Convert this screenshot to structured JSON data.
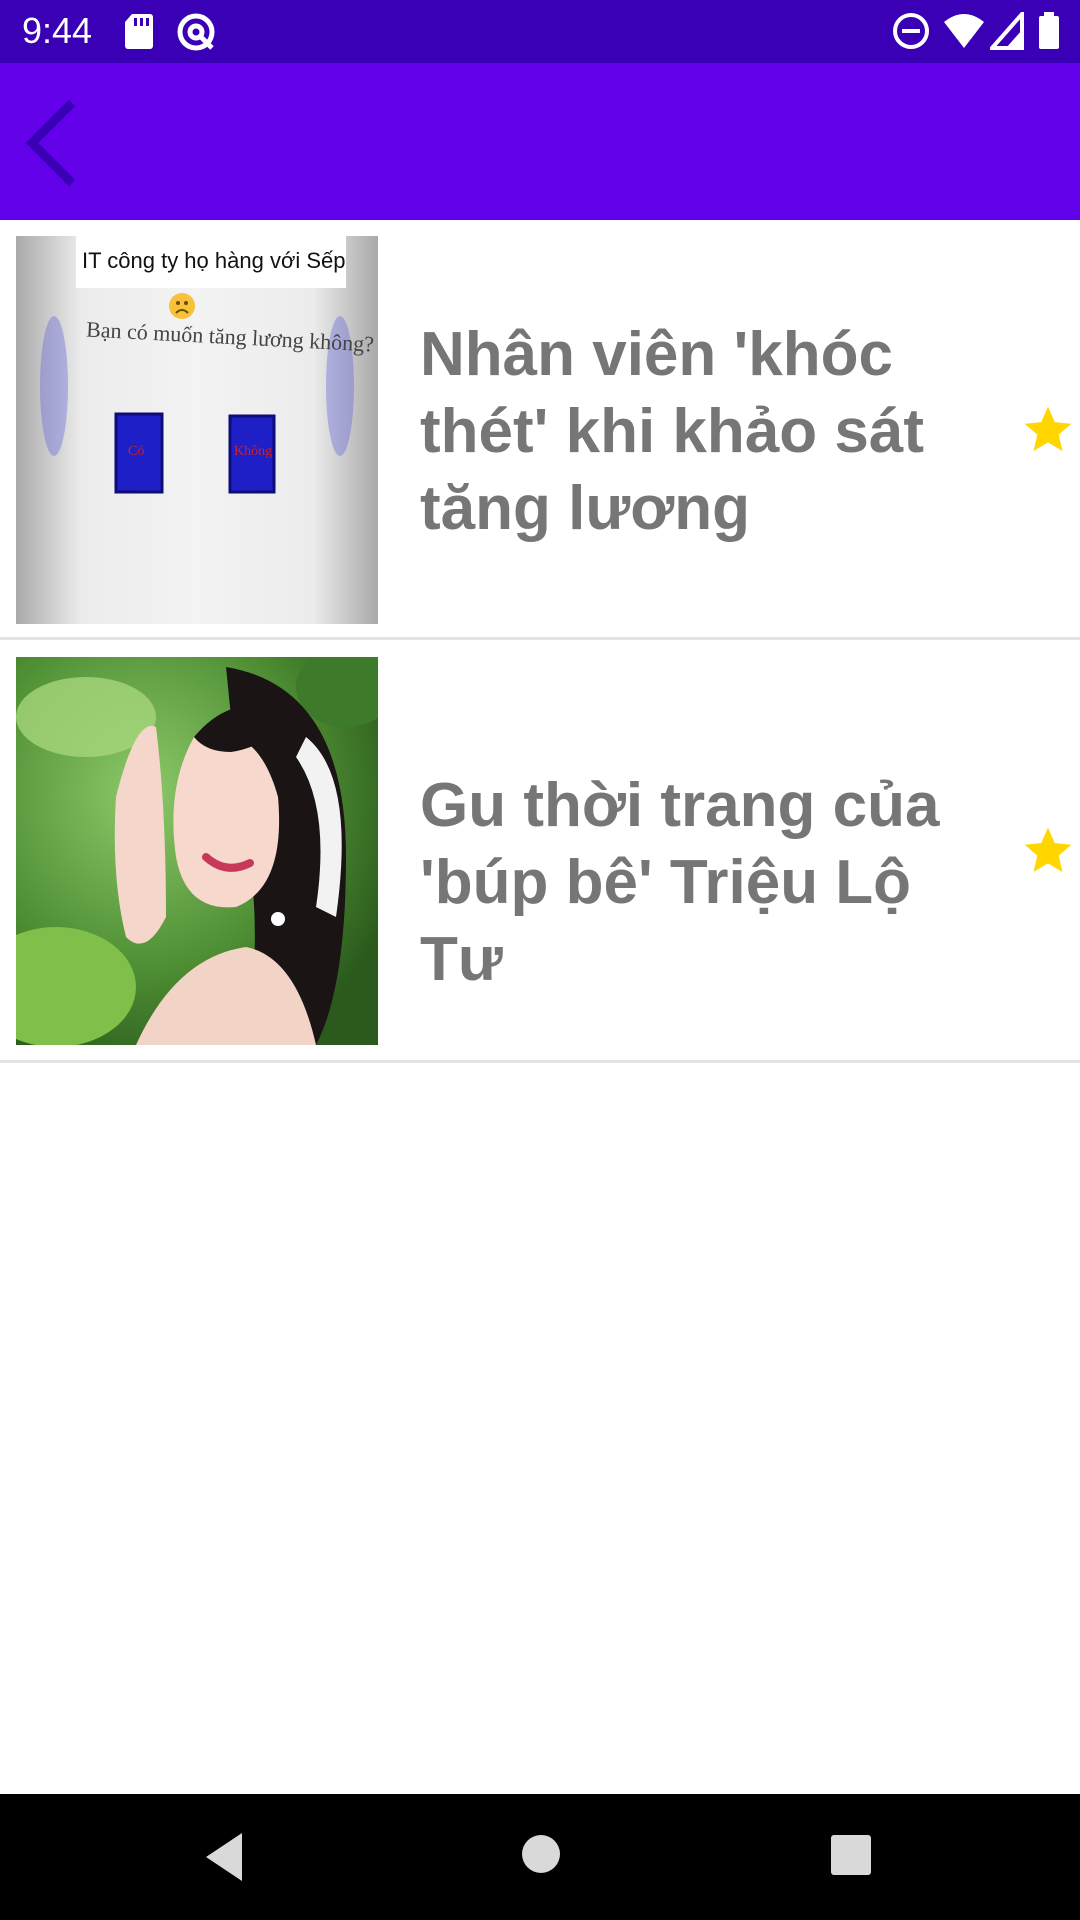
{
  "status_bar": {
    "time": "9:44",
    "icons": [
      "sd-card-icon",
      "vpn-key-icon",
      "do-not-disturb-icon",
      "wifi-icon",
      "signal-icon",
      "battery-icon"
    ]
  },
  "app_bar": {
    "back_icon": "chevron-left-icon",
    "color": "#6200ea",
    "back_color": "#3a00b5"
  },
  "articles": [
    {
      "title": "Nhân viên 'khóc thét' khi khảo sát tăng lương",
      "thumbnail": {
        "caption": "IT công ty họ hàng với Sếp",
        "question": "Bạn có muốn tăng lương không?",
        "option_yes": "Có",
        "option_no": "Không"
      },
      "starred": true
    },
    {
      "title": "Gu thời trang của 'búp bê' Triệu Lộ Tư",
      "thumbnail": {},
      "starred": true
    }
  ],
  "colors": {
    "status_bar": "#3a00b5",
    "title_text": "#767676",
    "star": "#ffd600",
    "divider": "#e3e3e3"
  },
  "nav_bar": {
    "icons": [
      "back-triangle-icon",
      "home-circle-icon",
      "recents-square-icon"
    ]
  }
}
